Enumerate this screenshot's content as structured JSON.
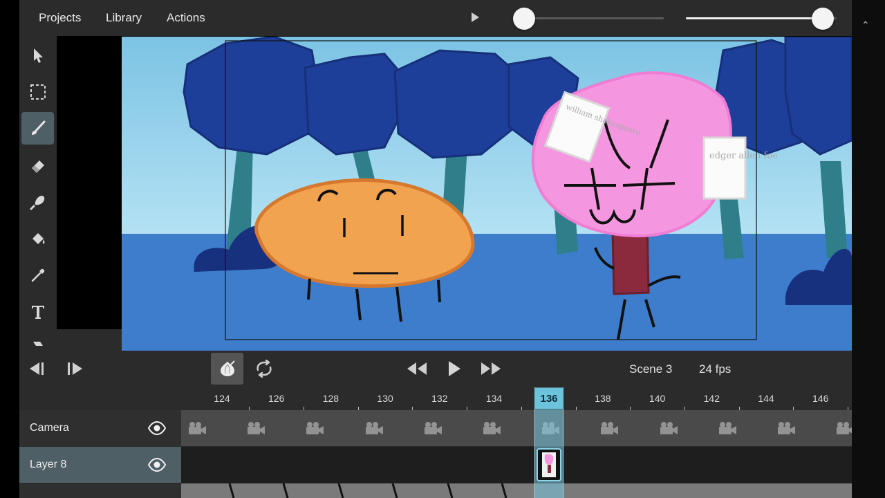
{
  "menu": {
    "projects": "Projects",
    "library": "Library",
    "actions": "Actions"
  },
  "playback": {
    "speed_slider_value": 0.03,
    "volume_slider_value": 0.9
  },
  "tools": [
    {
      "name": "select",
      "icon": "arrow-cursor-icon",
      "active": false
    },
    {
      "name": "marquee",
      "icon": "marquee-select-icon",
      "active": false
    },
    {
      "name": "brush",
      "icon": "brush-icon",
      "active": true
    },
    {
      "name": "eraser",
      "icon": "eraser-icon",
      "active": false
    },
    {
      "name": "smudge",
      "icon": "smudge-icon",
      "active": false
    },
    {
      "name": "fill",
      "icon": "paint-bucket-icon",
      "active": false
    },
    {
      "name": "eyedropper",
      "icon": "eyedropper-icon",
      "active": false
    },
    {
      "name": "text",
      "icon": "text-icon",
      "active": false
    },
    {
      "name": "more",
      "icon": "stamp-icon",
      "active": false
    }
  ],
  "canvas": {
    "note_left": "william shakespeare",
    "note_right": "edger allen foe",
    "sky_color": "#8ccbe6",
    "ground_color": "#3e7ccc"
  },
  "transport": {
    "scene": "Scene 3",
    "fps": "24 fps"
  },
  "timeline": {
    "frame_labels": [
      "124",
      "126",
      "128",
      "130",
      "132",
      "134",
      "136",
      "138",
      "140",
      "142",
      "144",
      "146"
    ],
    "current_frame": "136",
    "tracks": [
      {
        "name": "Camera",
        "visible": true
      },
      {
        "name": "Layer 8",
        "visible": true,
        "selected": true
      }
    ]
  },
  "colors": {
    "accent": "#6cc3dc",
    "selected_track": "#4e5f66",
    "panel": "#2b2b2b"
  }
}
